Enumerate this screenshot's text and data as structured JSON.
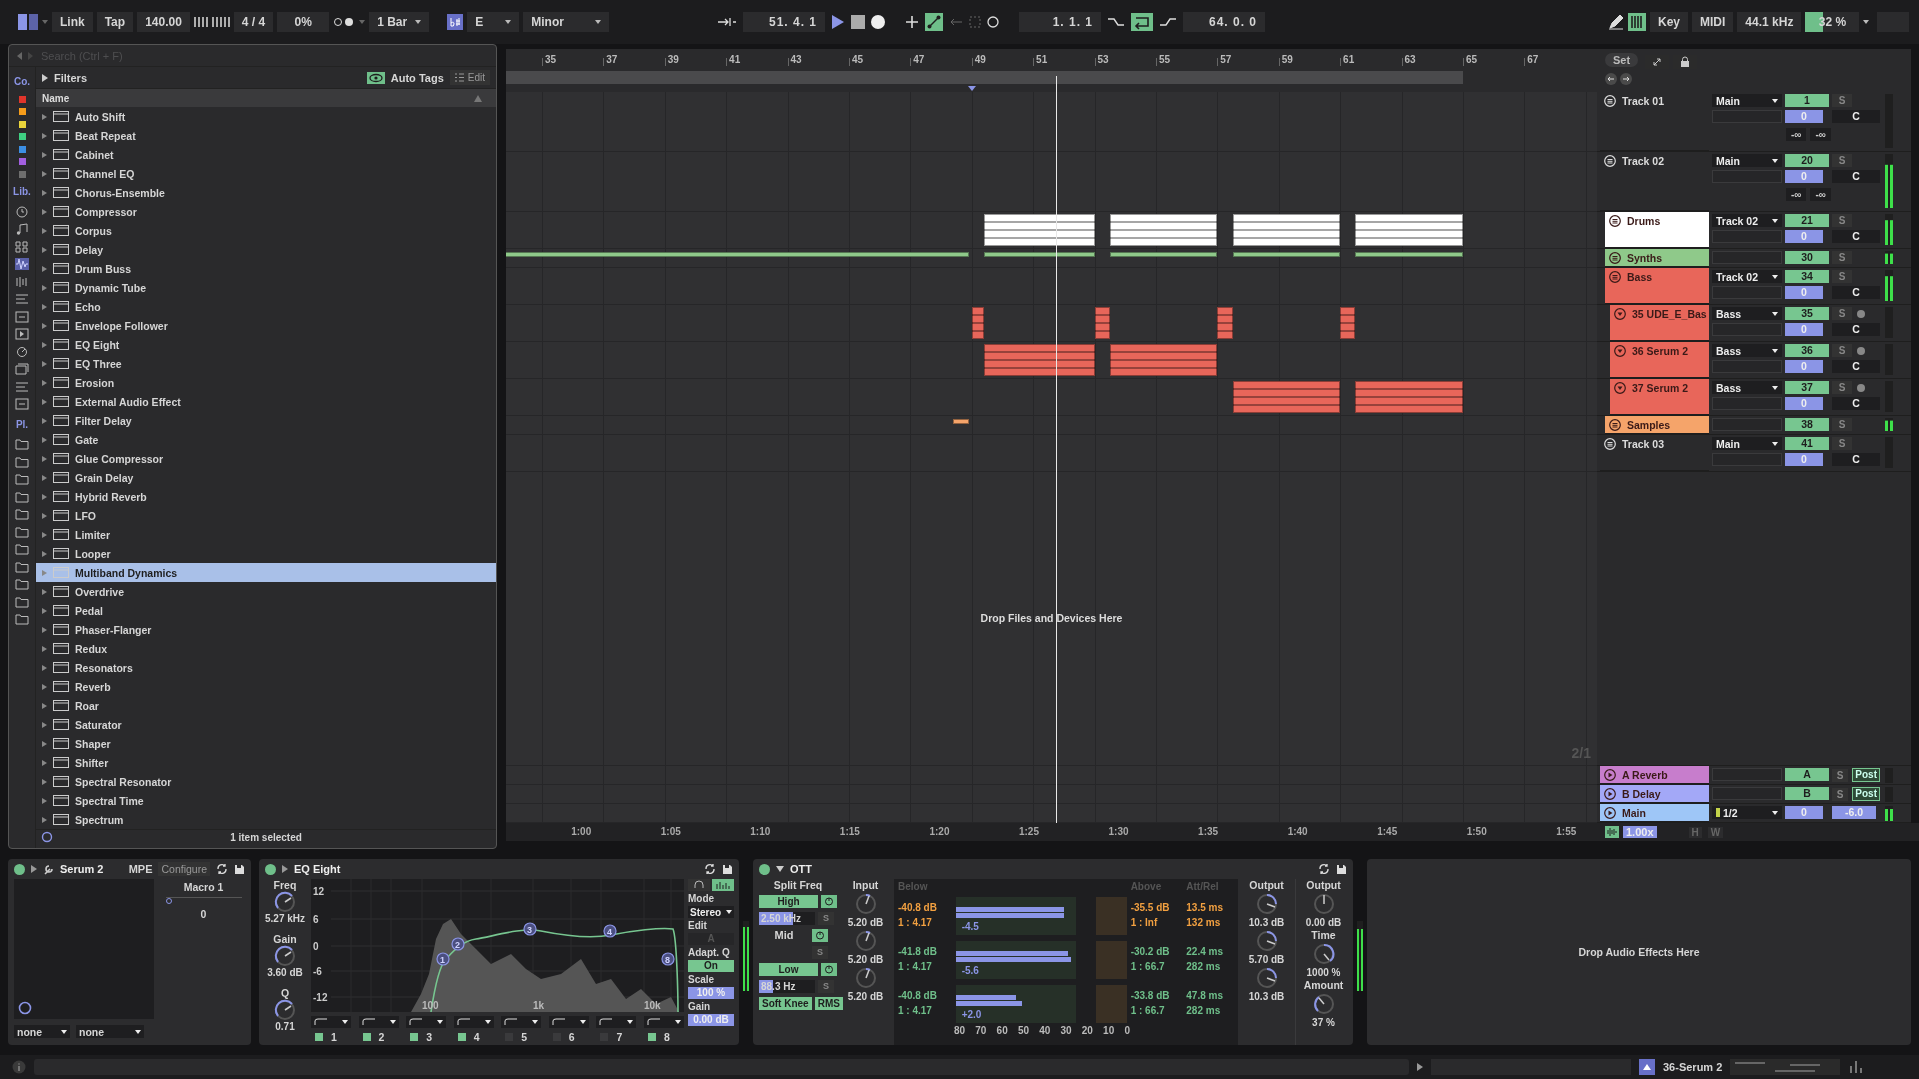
{
  "top_bar": {
    "link": "Link",
    "tap": "Tap",
    "tempo": "140.00",
    "signature": "4 / 4",
    "groove": "0%",
    "quantize": "1 Bar",
    "key": "E",
    "scale": "Minor",
    "position": "51. 4. 1",
    "loop_start": "1. 1. 1",
    "loop_on": true,
    "loop_length": "64. 0. 0",
    "key_map": "Key",
    "midi_map": "MIDI",
    "sample_rate": "44.1 kHz",
    "cpu": {
      "reading": "32 %",
      "level": 0.32
    }
  },
  "browser": {
    "search": {
      "placeholder": "Search (Ctrl + F)"
    },
    "filters": "Filters",
    "auto_tags": "Auto Tags",
    "edit": "Edit",
    "column": "Name",
    "collections_label": "Co.",
    "collections": [
      {
        "color": "#e0352b"
      },
      {
        "color": "#f59c1a"
      },
      {
        "color": "#e9d33b"
      },
      {
        "color": "#3fcf82"
      },
      {
        "color": "#3c8fe3"
      },
      {
        "color": "#a25fe0"
      },
      {
        "color": "#6e6e6e"
      }
    ],
    "library_label": "Lib.",
    "places_label": "Pl.",
    "items": [
      {
        "name": "Auto Shift",
        "selected": false
      },
      {
        "name": "Beat Repeat",
        "selected": false
      },
      {
        "name": "Cabinet",
        "selected": false
      },
      {
        "name": "Channel EQ",
        "selected": false
      },
      {
        "name": "Chorus-Ensemble",
        "selected": false
      },
      {
        "name": "Compressor",
        "selected": false
      },
      {
        "name": "Corpus",
        "selected": false
      },
      {
        "name": "Delay",
        "selected": false
      },
      {
        "name": "Drum Buss",
        "selected": false
      },
      {
        "name": "Dynamic Tube",
        "selected": false
      },
      {
        "name": "Echo",
        "selected": false
      },
      {
        "name": "Envelope Follower",
        "selected": false
      },
      {
        "name": "EQ Eight",
        "selected": false
      },
      {
        "name": "EQ Three",
        "selected": false
      },
      {
        "name": "Erosion",
        "selected": false
      },
      {
        "name": "External Audio Effect",
        "selected": false
      },
      {
        "name": "Filter Delay",
        "selected": false
      },
      {
        "name": "Gate",
        "selected": false
      },
      {
        "name": "Glue Compressor",
        "selected": false
      },
      {
        "name": "Grain Delay",
        "selected": false
      },
      {
        "name": "Hybrid Reverb",
        "selected": false
      },
      {
        "name": "LFO",
        "selected": false
      },
      {
        "name": "Limiter",
        "selected": false
      },
      {
        "name": "Looper",
        "selected": false
      },
      {
        "name": "Multiband Dynamics",
        "selected": true
      },
      {
        "name": "Overdrive",
        "selected": false
      },
      {
        "name": "Pedal",
        "selected": false
      },
      {
        "name": "Phaser-Flanger",
        "selected": false
      },
      {
        "name": "Redux",
        "selected": false
      },
      {
        "name": "Resonators",
        "selected": false
      },
      {
        "name": "Reverb",
        "selected": false
      },
      {
        "name": "Roar",
        "selected": false
      },
      {
        "name": "Saturator",
        "selected": false
      },
      {
        "name": "Shaper",
        "selected": false
      },
      {
        "name": "Shifter",
        "selected": false
      },
      {
        "name": "Spectral Resonator",
        "selected": false
      },
      {
        "name": "Spectral Time",
        "selected": false
      },
      {
        "name": "Spectrum",
        "selected": false
      }
    ],
    "footer": "1 item selected"
  },
  "arrangement": {
    "ruler": [
      "35",
      "37",
      "39",
      "41",
      "43",
      "45",
      "47",
      "49",
      "51",
      "53",
      "55",
      "57",
      "59",
      "61",
      "63",
      "65",
      "67"
    ],
    "time_ruler": [
      "1:00",
      "1:05",
      "1:10",
      "1:15",
      "1:20",
      "1:25",
      "1:30",
      "1:35",
      "1:40",
      "1:45",
      "1:50",
      "1:55"
    ],
    "drop_hint": "Drop Files and Devices Here",
    "zoom_label": "2/1"
  },
  "mixer": {
    "set": "Set",
    "tracks": [
      {
        "name": "Track 01",
        "kind": "group",
        "expanded": true,
        "routing": "Main",
        "number": "1",
        "solo": "S",
        "volume": "0",
        "pan": "C",
        "peaks": [
          "-∞",
          "-∞"
        ]
      },
      {
        "name": "Track 02",
        "kind": "group",
        "expanded": true,
        "routing": "Main",
        "number": "20",
        "solo": "S",
        "volume": "0",
        "pan": "C",
        "peaks": [
          "-∞",
          "-∞"
        ],
        "children": [
          {
            "name": "Drums",
            "kind": "group",
            "color": "#ffffff",
            "expanded": true,
            "routing": "Track 02",
            "number": "21",
            "solo": "S",
            "volume": "0",
            "pan": "C"
          },
          {
            "name": "Synths",
            "kind": "group",
            "color": "#8fc98a",
            "expanded": false,
            "number": "30",
            "solo": "S"
          },
          {
            "name": "Bass",
            "kind": "group",
            "color": "#e8665a",
            "expanded": true,
            "routing": "Track 02",
            "number": "34",
            "solo": "S",
            "volume": "0",
            "pan": "C",
            "children": [
              {
                "name": "35 UDE_E_Bas",
                "kind": "instrument",
                "color": "#e8665a",
                "expanded": true,
                "routing": "Bass",
                "number": "35",
                "solo": "S",
                "volume": "0",
                "pan": "C"
              },
              {
                "name": "36 Serum 2",
                "kind": "instrument",
                "color": "#e8665a",
                "expanded": true,
                "routing": "Bass",
                "number": "36",
                "solo": "S",
                "volume": "0",
                "pan": "C"
              },
              {
                "name": "37 Serum 2",
                "kind": "instrument",
                "color": "#e8665a",
                "expanded": true,
                "routing": "Bass",
                "number": "37",
                "solo": "S",
                "volume": "0",
                "pan": "C"
              }
            ]
          },
          {
            "name": "Samples",
            "kind": "group",
            "color": "#f5a46a",
            "expanded": false,
            "number": "38",
            "solo": "S"
          }
        ]
      },
      {
        "name": "Track 03",
        "kind": "group",
        "expanded": true,
        "routing": "Main",
        "number": "41",
        "solo": "S",
        "volume": "0",
        "pan": "C"
      }
    ],
    "returns": [
      {
        "kind": "return",
        "name": "A Reverb",
        "color": "#c77dcc",
        "send": "A",
        "solo": "S",
        "post": "Post"
      },
      {
        "kind": "return",
        "name": "B Delay",
        "color": "#a3a8f7",
        "send": "B",
        "solo": "S",
        "post": "Post"
      },
      {
        "kind": "main",
        "name": "Main",
        "color": "#9ec6f7",
        "routing": "1/2",
        "volume": "0",
        "pan": "-6.0"
      }
    ],
    "tempo_scale": "1.00x",
    "h": "H",
    "w": "W"
  },
  "devices": [
    {
      "kind": "instrument",
      "name": "Serum 2",
      "on": true,
      "mpe": "MPE",
      "configure": "Configure",
      "macro": {
        "label": "Macro 1",
        "value": "0",
        "level": 0
      },
      "selectors": [
        "none",
        "none"
      ]
    },
    {
      "kind": "eq",
      "name": "EQ Eight",
      "on": true,
      "knobs": [
        {
          "label": "Freq",
          "value": "5.27 kHz"
        },
        {
          "label": "Gain",
          "value": "3.60 dB"
        },
        {
          "label": "Q",
          "value": "0.71"
        }
      ],
      "yticks": [
        "12",
        "6",
        "0",
        "-6",
        "-12"
      ],
      "xticks": [
        "100",
        "1k",
        "10k"
      ],
      "bands": [
        {
          "number": "1",
          "on": true,
          "node": "1"
        },
        {
          "number": "2",
          "on": true,
          "node": "2"
        },
        {
          "number": "3",
          "on": true,
          "node": "3"
        },
        {
          "number": "4",
          "on": true,
          "node": "4"
        },
        {
          "number": "5",
          "on": false
        },
        {
          "number": "6",
          "on": false
        },
        {
          "number": "7",
          "on": false
        },
        {
          "number": "8",
          "on": true,
          "node": "8"
        }
      ],
      "mode_label": "Mode",
      "mode": "Stereo",
      "edit_label": "Edit",
      "edit": "A",
      "adapt_label": "Adapt. Q",
      "adapt": "On",
      "scale_label": "Scale",
      "scale": "100 %",
      "gain_label": "Gain",
      "gain": "0.00 dB"
    },
    {
      "kind": "ott",
      "name": "OTT",
      "on": true,
      "split_label": "Split Freq",
      "high": "High",
      "high_freq": {
        "reading": "2.50 kHz",
        "level": 0.6
      },
      "mid": "Mid",
      "low": "Low",
      "low_freq": {
        "reading": "88.3 Hz",
        "level": 0.25
      },
      "soft_knee": "Soft Knee",
      "rms": "RMS",
      "input_label": "Input",
      "below_label": "Below",
      "above_label": "Above",
      "att_label": "Att/Rel",
      "bands": [
        {
          "solo": "S",
          "input": "5.20 dB",
          "below": "-40.8 dB",
          "below_ratio": "1 : 4.17",
          "gain": "-4.5",
          "above": "-35.5 dB",
          "above_ratio": "1 : Inf",
          "attack": "13.5 ms",
          "release": "132 ms",
          "output": "10.3 dB",
          "active": true
        },
        {
          "solo": "S",
          "input": "5.20 dB",
          "below": "-41.8 dB",
          "below_ratio": "1 : 4.17",
          "gain": "-5.6",
          "above": "-30.2 dB",
          "above_ratio": "1 : 66.7",
          "attack": "22.4 ms",
          "release": "282 ms",
          "output": "5.70 dB",
          "active": false
        },
        {
          "solo": "S",
          "input": "5.20 dB",
          "below": "-40.8 dB",
          "below_ratio": "1 : 4.17",
          "gain": "+2.0",
          "above": "-33.8 dB",
          "above_ratio": "1 : 66.7",
          "attack": "47.8 ms",
          "release": "282 ms",
          "output": "10.3 dB",
          "active": false
        }
      ],
      "scale_ticks": [
        "80",
        "70",
        "60",
        "50",
        "40",
        "30",
        "20",
        "10",
        "0"
      ],
      "output_label": "Output",
      "master_output": {
        "label": "Output",
        "value": "0.00 dB"
      },
      "time": {
        "label": "Time",
        "value": "1000 %"
      },
      "amount": {
        "label": "Amount",
        "value": "37 %"
      }
    },
    {
      "kind": "drop",
      "hint": "Drop Audio Effects Here"
    }
  ],
  "status_bar": {
    "track": "36-Serum 2"
  }
}
